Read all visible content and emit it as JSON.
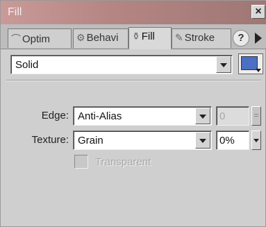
{
  "window": {
    "title": "Fill",
    "close_glyph": "×"
  },
  "tabs": [
    {
      "label": "Optim",
      "icon": "optimize-icon",
      "glyph": "⌒"
    },
    {
      "label": "Behavi",
      "icon": "behaviors-icon",
      "glyph": "⚙"
    },
    {
      "label": "Fill",
      "icon": "fill-bucket-icon",
      "glyph": "⚱"
    },
    {
      "label": "Stroke",
      "icon": "pencil-icon",
      "glyph": "✎"
    }
  ],
  "toolbar": {
    "help_glyph": "?"
  },
  "fill": {
    "type": "Solid",
    "color": "#4a6fc4"
  },
  "edge": {
    "label": "Edge:",
    "value": "Anti-Alias",
    "amount": "0"
  },
  "texture": {
    "label": "Texture:",
    "value": "Grain",
    "amount": "0%"
  },
  "transparent": {
    "label": "Transparent",
    "checked": false
  }
}
